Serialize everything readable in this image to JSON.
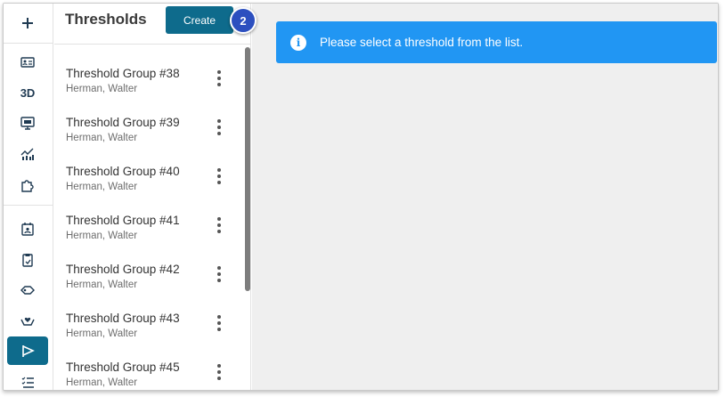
{
  "rail": {
    "items": [
      {
        "name": "add",
        "icon": "plus-icon"
      },
      {
        "name": "id-card",
        "icon": "id-card-icon"
      },
      {
        "name": "3d",
        "label": "3D"
      },
      {
        "name": "ad-monitor",
        "icon": "ad-monitor-icon"
      },
      {
        "name": "analytics",
        "icon": "chart-icon"
      },
      {
        "name": "plugins",
        "icon": "puzzle-icon"
      },
      {
        "name": "calendar-user",
        "icon": "calendar-user-icon"
      },
      {
        "name": "clipboard",
        "icon": "clipboard-icon"
      },
      {
        "name": "tag",
        "icon": "tag-icon"
      },
      {
        "name": "care",
        "icon": "hands-heart-icon"
      },
      {
        "name": "thresholds",
        "icon": "flag-icon",
        "active": true
      },
      {
        "name": "list",
        "icon": "list-icon"
      }
    ]
  },
  "panel": {
    "title": "Thresholds",
    "create_label": "Create",
    "step_badge": "2",
    "items": [
      {
        "title": "Threshold Group #38",
        "owner": "Herman, Walter"
      },
      {
        "title": "Threshold Group #39",
        "owner": "Herman, Walter"
      },
      {
        "title": "Threshold Group #40",
        "owner": "Herman, Walter"
      },
      {
        "title": "Threshold Group #41",
        "owner": "Herman, Walter"
      },
      {
        "title": "Threshold Group #42",
        "owner": "Herman, Walter"
      },
      {
        "title": "Threshold Group #43",
        "owner": "Herman, Walter"
      },
      {
        "title": "Threshold Group #45",
        "owner": "Herman, Walter"
      }
    ]
  },
  "main": {
    "alert": {
      "icon": "info-icon",
      "text": "Please select a threshold from the list."
    }
  },
  "colors": {
    "accent": "#0e6b8c",
    "alert_blue": "#2196f3",
    "badge": "#2c4fbf",
    "main_bg": "#efefef"
  }
}
